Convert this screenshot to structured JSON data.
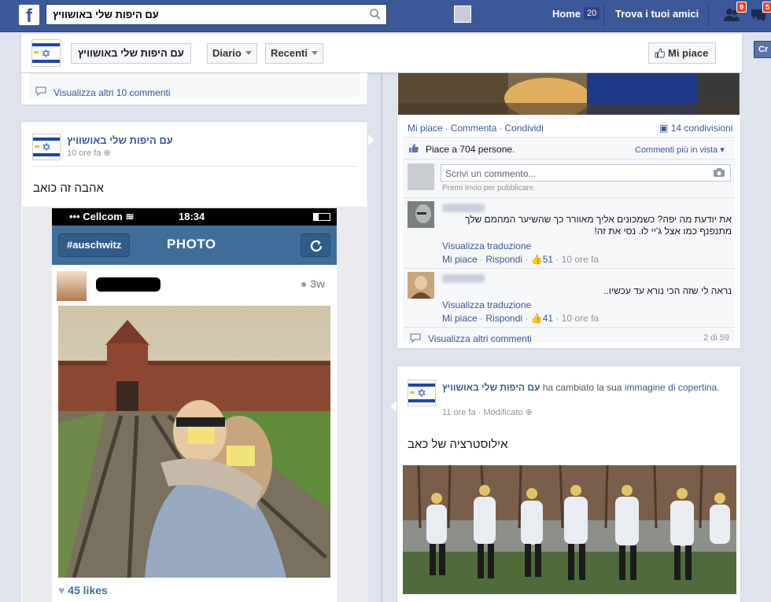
{
  "topbar": {
    "search_value": "עם היפות שלי באושוויץ",
    "home_label": "Home",
    "home_count": "20",
    "find_friends_label": "Trova i tuoi amici",
    "friend_requests_count": "9",
    "messages_count": "5"
  },
  "page_header": {
    "page_name": "עם היפות שלי באושוויץ",
    "diario_label": "Diario",
    "recenti_label": "Recenti",
    "like_label": "Mi piace",
    "cr_label": "Cr"
  },
  "left_top_card": {
    "more_comments": "Visualizza altri 10 commenti"
  },
  "left_post": {
    "author": "עם היפות שלי באושוויץ",
    "time": "10 ore fa",
    "text": "אהבה זה כואב",
    "instagram": {
      "carrier": "Cellcom",
      "clock": "18:34",
      "hashtag": "#auschwitz",
      "title": "PHOTO",
      "posted_ago": "3w",
      "likes": "45 likes"
    }
  },
  "right_post_1": {
    "actions": [
      "Mi piace",
      "Commenta",
      "Condividi"
    ],
    "shares": "14 condivisioni",
    "likes_text": "Piace a 704 persone.",
    "comment_order": "Commenti più in vista",
    "comment_placeholder": "Scrivi un commento...",
    "enter_hint": "Premi Invio per pubblicare.",
    "comments": [
      {
        "text": "את יודעת מה יפה? כשמכונים אליך מאוורר כך שהשיער המהמם שלך מתנפנף כמו אצל ג'יי לו. נסי את זה!",
        "translate": "Visualizza traduzione",
        "like": "Mi piace",
        "reply": "Rispondi",
        "likes": "51",
        "time": "10 ore fa"
      },
      {
        "text": "נראה לי שזה הכי נורא עד עכשיו..",
        "translate": "Visualizza traduzione",
        "like": "Mi piace",
        "reply": "Rispondi",
        "likes": "41",
        "time": "10 ore fa"
      }
    ],
    "more_comments": "Visualizza altri commenti",
    "count": "2 di 59"
  },
  "right_post_2": {
    "author": "עם היפות שלי באושוויץ",
    "changed_text": "ha cambiato la sua",
    "cover_link": "immagine di copertina.",
    "time": "11 ore fa",
    "modified": "Modificato",
    "text": "אילוסטרציה של כאב"
  },
  "colors": {
    "facebook_blue": "#3b5998",
    "instagram_blue": "#3f6e9b",
    "page_bg": "#dfe3ee"
  }
}
